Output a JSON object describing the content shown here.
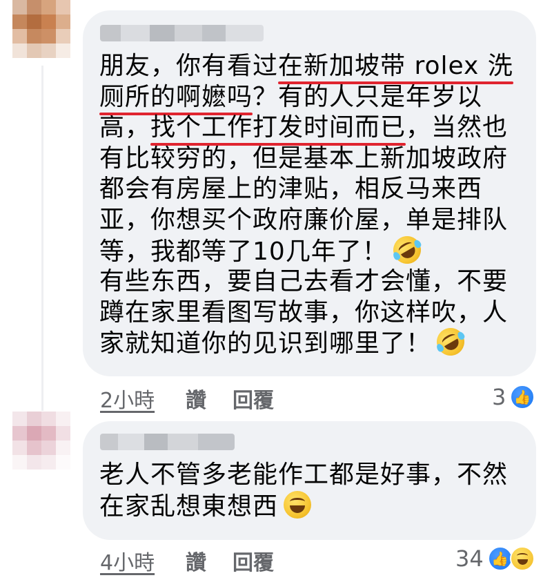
{
  "comments": [
    {
      "lines": [
        {
          "parts": [
            {
              "t": "朋友，你有看过"
            },
            {
              "t": "在新加坡带 rolex 洗",
              "u": true
            }
          ]
        },
        {
          "parts": [
            {
              "t": "厕所的啊嬷吗",
              "u": true
            },
            {
              "t": "？有的人只是年岁以"
            }
          ]
        },
        {
          "parts": [
            {
              "t": "高，"
            },
            {
              "t": "找个工作打发时间而已",
              "u": true
            },
            {
              "t": "，当然也"
            }
          ]
        },
        {
          "parts": [
            {
              "t": "有比较穷的，但是基本上新加坡政府"
            }
          ]
        },
        {
          "parts": [
            {
              "t": "都会有房屋上的津贴，相反马来西"
            }
          ]
        },
        {
          "parts": [
            {
              "t": "亚，你想买个政府廉价屋，单是排队"
            }
          ]
        },
        {
          "parts": [
            {
              "t": "等，我都等了10几年了！"
            }
          ],
          "emoji": "rofl"
        },
        {
          "parts": [
            {
              "t": "有些东西，要自己去看才会懂，不要"
            }
          ]
        },
        {
          "parts": [
            {
              "t": "蹲在家里看图写故事，你这样吹，人"
            }
          ]
        },
        {
          "parts": [
            {
              "t": "家就知道你的见识到哪里了！"
            }
          ],
          "emoji": "rofl"
        }
      ],
      "time": "2小時",
      "like_label": "讚",
      "reply_label": "回覆",
      "reaction_count": "3",
      "reactions": [
        "like-icon"
      ]
    },
    {
      "lines": [
        {
          "parts": [
            {
              "t": "老人不管多老能作工都是好事，不然"
            }
          ]
        },
        {
          "parts": [
            {
              "t": "在家乱想東想西"
            }
          ],
          "emoji": "grin"
        }
      ],
      "time": "4小時",
      "like_label": "讚",
      "reply_label": "回覆",
      "reaction_count": "34",
      "reactions": [
        "like-icon",
        "haha-icon"
      ]
    }
  ],
  "colors": {
    "bubble": "#f0f2f5",
    "underline": "#e0242f",
    "meta_text": "#65676b",
    "like_blue": "#1877f2"
  }
}
